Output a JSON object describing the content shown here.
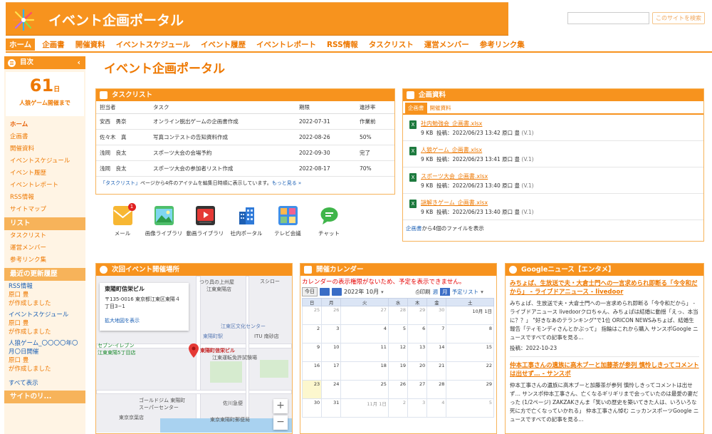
{
  "header": {
    "title": "イベント企画ポータル",
    "search_placeholder": "",
    "search_button": "このサイトを検索"
  },
  "nav": [
    "ホーム",
    "企画書",
    "開催資料",
    "イベントスケジュール",
    "イベント履歴",
    "イベントレポート",
    "RSS情報",
    "タスクリスト",
    "運営メンバー",
    "参考リンク集"
  ],
  "sidebar": {
    "header": "目次",
    "countdown": {
      "number": "61",
      "unit": "日",
      "label": "人狼ゲーム開催まで"
    },
    "links": [
      "ホーム",
      "企画書",
      "開催資料",
      "イベントスケジュール",
      "イベント履歴",
      "イベントレポート",
      "RSS情報",
      "サイトマップ"
    ],
    "list_section": "リスト",
    "list_links": [
      "タスクリスト",
      "運営メンバー",
      "参考リンク集"
    ],
    "updates_section": "最近の更新履歴",
    "updates": [
      {
        "title": "RSS情報",
        "user": "原口 豊",
        "desc": "が作成しました"
      },
      {
        "title": "イベントスケジュール",
        "user": "原口 豊",
        "desc": "が作成しました"
      },
      {
        "title": "人狼ゲーム_〇〇〇〇年〇月〇日開催",
        "user": "原口 豊",
        "desc": "が作成しました"
      }
    ],
    "show_all": "すべて表示",
    "bottom_section": "サイトのリ..."
  },
  "page_title": "イベント企画ポータル",
  "tasks": {
    "title": "タスクリスト",
    "columns": [
      "担当者",
      "タスク",
      "期限",
      "進捗率"
    ],
    "rows": [
      [
        "安西　勇奈",
        "オンライン脱出ゲームの企画書作成",
        "2022-07-31",
        "作業前"
      ],
      [
        "佐々木　真",
        "写真コンテストの告知資料作成",
        "2022-08-26",
        "50%"
      ],
      [
        "浅岡　良太",
        "スポーツ大会の会場予約",
        "2022-09-30",
        "完了"
      ],
      [
        "浅岡　良太",
        "スポーツ大会の参加者リスト作成",
        "2022-08-17",
        "70%"
      ]
    ],
    "note_link": "「タスクリスト」",
    "note": "ページから4件のアイテムを編集日時順に表示しています。",
    "more": "もっと見る »"
  },
  "apps": [
    {
      "label": "メール",
      "icon": "mail-icon",
      "badge": "1"
    },
    {
      "label": "画像ライブラリ",
      "icon": "image-library-icon"
    },
    {
      "label": "動画ライブラリ",
      "icon": "video-library-icon"
    },
    {
      "label": "社内ポータル",
      "icon": "building-icon"
    },
    {
      "label": "テレビ会議",
      "icon": "video-conference-icon"
    },
    {
      "label": "チャット",
      "icon": "chat-icon"
    }
  ],
  "docs": {
    "title": "企画資料",
    "tabs": [
      "企画書",
      "開催資料"
    ],
    "files": [
      {
        "name": "社内勉強会_企画書.xlsx",
        "size": "9 KB",
        "posted": "投稿：2022/06/23 13:42 原口 豊",
        "ver": "(V.1)"
      },
      {
        "name": "人狼ゲーム_企画書.xlsx",
        "size": "9 KB",
        "posted": "投稿：2022/06/23 13:41 原口 豊",
        "ver": "(V.1)"
      },
      {
        "name": "スポーツ大会_企画書.xlsx",
        "size": "9 KB",
        "posted": "投稿：2022/06/23 13:40 原口 豊",
        "ver": "(V.1)"
      },
      {
        "name": "謎解きゲーム_企画書.xlsx",
        "size": "9 KB",
        "posted": "投稿：2022/06/23 13:40 原口 豊",
        "ver": "(V.1)"
      }
    ],
    "footer_link": "企画書",
    "footer": "から4個のファイルを表示"
  },
  "map": {
    "title": "次回イベント開催場所",
    "name": "東陽町信栄ビル",
    "address": "〒135-0016 東京都江東区東陽４丁目3−1",
    "link": "拡大地図を表示",
    "pin_label": "東陽町信栄ビル",
    "labels": [
      "つり具の上州屋",
      "江東東陽店",
      "江東区文化センター",
      "東陽町駅",
      "ITU 南砂店",
      "江東運転免許試験場",
      "セブン-イレブン",
      "江東東陽5丁目店",
      "ゴールドジム 東陽町スーパーセンター",
      "東京京葉店",
      "佐川急便",
      "東京東陽町郵便局",
      "スシロー"
    ],
    "zoom_in": "+",
    "zoom_out": "−"
  },
  "calendar": {
    "title": "開催カレンダー",
    "error": "カレンダーの表示権限がないため、予定を表示できません。",
    "today_btn": "今日",
    "month": "2022年 10月",
    "print": "印刷",
    "views": [
      "週",
      "月",
      "予定リスト"
    ],
    "weekdays": [
      "日",
      "月",
      "火",
      "水",
      "木",
      "金",
      "土"
    ],
    "weeks": [
      [
        "25",
        "26",
        "27",
        "28",
        "29",
        "30",
        "10月 1日"
      ],
      [
        "2",
        "3",
        "4",
        "5",
        "6",
        "7",
        "8"
      ],
      [
        "9",
        "10",
        "11",
        "12",
        "13",
        "14",
        "15"
      ],
      [
        "16",
        "17",
        "18",
        "19",
        "20",
        "21",
        "22"
      ],
      [
        "23",
        "24",
        "25",
        "26",
        "27",
        "28",
        "29"
      ],
      [
        "30",
        "31",
        "11月 1日",
        "2",
        "3",
        "4",
        "5"
      ]
    ],
    "today": "23"
  },
  "news": {
    "title": "Googleニュース【エンタメ】",
    "items": [
      {
        "headline": "みちょぱ、生放送で夫・大倉士門への一言求められ即断る「今令和だから」 - ライブドアニュース - livedoor",
        "body": "みちょぱ、生放送で夫・大倉士門への一言求められ即断る「今令和だから」 - ライブドアニュース livedoorクロちゃん、みちょぱは結婚に動揺「えっ、本当に？？」 \"好きなあのテランキング\"で1位 ORICON NEWSみちょぱ、結婚生報告「ティモンディさんとかぶって」 指輪はこれから購入 サンスポGoogle ニュースですべての記事を見る...",
        "date": "投稿：2022-10-23"
      },
      {
        "headline": "仲本工事さんの遺族に高木ブーと加藤茶が参列 慎怜しきってコメントは出せず… - サンスポ",
        "body": "仲本工事さんの遺族に高木ブーと加藤茶が参列 慎怜しきってコメントは出せず… サンスポ仲本工事さん、亡くなるギリギリまで会っていたのは最愛の妻だった (1/2ページ) ZAKZAKさんま「笑いの歴史を築いてきた人は、いろいろな死に方で亡くなっていかれる」 仲本工事さん悼む ニッカンスポーツGoogle ニュースですべての記事を見る..."
      }
    ]
  }
}
